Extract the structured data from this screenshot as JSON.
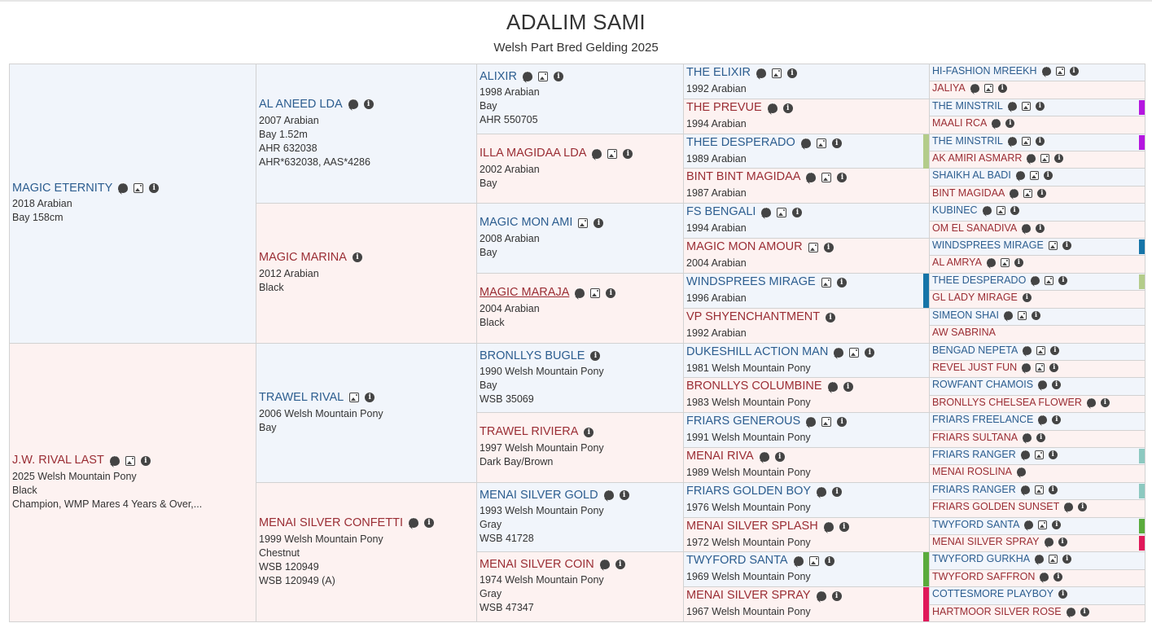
{
  "header": {
    "title": "ADALIM SAMI",
    "subtitle": "Welsh Part Bred Gelding 2025"
  },
  "pedigree": {
    "gen1": [
      {
        "name": "MAGIC ETERNITY",
        "sex": "m",
        "icons": [
          "comment",
          "image",
          "info"
        ],
        "lines": [
          "2018 Arabian",
          "Bay 158cm"
        ]
      },
      {
        "name": "J.W. RIVAL LAST",
        "sex": "f",
        "icons": [
          "comment",
          "image",
          "info"
        ],
        "lines": [
          "2025 Welsh Mountain Pony",
          "Black",
          "Champion, WMP Mares 4 Years & Over,..."
        ]
      }
    ],
    "gen2": [
      {
        "name": "AL ANEED LDA",
        "sex": "m",
        "icons": [
          "comment",
          "info"
        ],
        "lines": [
          "2007 Arabian",
          "Bay 1.52m",
          "AHR 632038",
          "AHR*632038, AAS*4286"
        ]
      },
      {
        "name": "MAGIC MARINA",
        "sex": "f",
        "icons": [
          "info"
        ],
        "lines": [
          "2012 Arabian",
          "Black"
        ]
      },
      {
        "name": "TRAWEL RIVAL",
        "sex": "m",
        "icons": [
          "image",
          "info"
        ],
        "lines": [
          "2006 Welsh Mountain Pony",
          "Bay"
        ]
      },
      {
        "name": "MENAI SILVER CONFETTI",
        "sex": "f",
        "icons": [
          "comment",
          "info"
        ],
        "lines": [
          "1999 Welsh Mountain Pony",
          "Chestnut",
          "WSB 120949",
          "WSB 120949 (A)"
        ]
      }
    ],
    "gen3": [
      {
        "name": "ALIXIR",
        "sex": "m",
        "icons": [
          "comment",
          "image",
          "info"
        ],
        "lines": [
          "1998 Arabian",
          "Bay",
          "AHR 550705"
        ]
      },
      {
        "name": "ILLA MAGIDAA LDA",
        "sex": "f",
        "icons": [
          "comment",
          "image",
          "info"
        ],
        "lines": [
          "2002 Arabian",
          "Bay"
        ]
      },
      {
        "name": "MAGIC MON AMI",
        "sex": "m",
        "icons": [
          "image",
          "info"
        ],
        "lines": [
          "2008 Arabian",
          "Bay"
        ]
      },
      {
        "name": "MAGIC MARAJA",
        "sex": "f",
        "underline": true,
        "icons": [
          "comment",
          "image",
          "info"
        ],
        "lines": [
          "2004 Arabian",
          "Black"
        ]
      },
      {
        "name": "BRONLLYS BUGLE",
        "sex": "m",
        "icons": [
          "info"
        ],
        "lines": [
          "1990 Welsh Mountain Pony",
          "Bay",
          "WSB 35069"
        ]
      },
      {
        "name": "TRAWEL RIVIERA",
        "sex": "f",
        "icons": [
          "info"
        ],
        "lines": [
          "1997 Welsh Mountain Pony",
          "Dark Bay/Brown"
        ]
      },
      {
        "name": "MENAI SILVER GOLD",
        "sex": "m",
        "icons": [
          "comment",
          "info"
        ],
        "lines": [
          "1993 Welsh Mountain Pony",
          "Gray",
          "WSB 41728"
        ]
      },
      {
        "name": "MENAI SILVER COIN",
        "sex": "f",
        "icons": [
          "comment",
          "info"
        ],
        "lines": [
          "1974 Welsh Mountain Pony",
          "Gray",
          "WSB 47347"
        ]
      }
    ],
    "gen4": [
      {
        "name": "THE ELIXIR",
        "sex": "m",
        "icons": [
          "comment",
          "image",
          "info"
        ],
        "lines": [
          "1992 Arabian"
        ]
      },
      {
        "name": "THE PREVUE",
        "sex": "f",
        "icons": [
          "comment",
          "info"
        ],
        "lines": [
          "1994 Arabian"
        ]
      },
      {
        "name": "THEE DESPERADO",
        "sex": "m",
        "icons": [
          "comment",
          "image",
          "info"
        ],
        "lines": [
          "1989 Arabian"
        ],
        "marker": "#b3cc8a"
      },
      {
        "name": "BINT BINT MAGIDAA",
        "sex": "f",
        "icons": [
          "comment",
          "image",
          "info"
        ],
        "lines": [
          "1987 Arabian"
        ]
      },
      {
        "name": "FS BENGALI",
        "sex": "m",
        "icons": [
          "comment",
          "image",
          "info"
        ],
        "lines": [
          "1994 Arabian"
        ]
      },
      {
        "name": "MAGIC MON AMOUR",
        "sex": "f",
        "icons": [
          "image",
          "info"
        ],
        "lines": [
          "2004 Arabian"
        ]
      },
      {
        "name": "WINDSPREES MIRAGE",
        "sex": "m",
        "icons": [
          "image",
          "info"
        ],
        "lines": [
          "1996 Arabian"
        ],
        "marker": "#1675a8"
      },
      {
        "name": "VP SHYENCHANTMENT",
        "sex": "f",
        "icons": [
          "info"
        ],
        "lines": [
          "1992 Arabian"
        ]
      },
      {
        "name": "DUKESHILL ACTION MAN",
        "sex": "m",
        "icons": [
          "comment",
          "image",
          "info"
        ],
        "lines": [
          "1981 Welsh Mountain Pony"
        ]
      },
      {
        "name": "BRONLLYS COLUMBINE",
        "sex": "f",
        "icons": [
          "comment",
          "info"
        ],
        "lines": [
          "1983 Welsh Mountain Pony"
        ]
      },
      {
        "name": "FRIARS GENEROUS",
        "sex": "m",
        "icons": [
          "comment",
          "image",
          "info"
        ],
        "lines": [
          "1991 Welsh Mountain Pony"
        ]
      },
      {
        "name": "MENAI RIVA",
        "sex": "f",
        "icons": [
          "comment",
          "info"
        ],
        "lines": [
          "1989 Welsh Mountain Pony"
        ]
      },
      {
        "name": "FRIARS GOLDEN BOY",
        "sex": "m",
        "icons": [
          "comment",
          "info"
        ],
        "lines": [
          "1976 Welsh Mountain Pony"
        ]
      },
      {
        "name": "MENAI SILVER SPLASH",
        "sex": "f",
        "icons": [
          "comment",
          "info"
        ],
        "lines": [
          "1972 Welsh Mountain Pony"
        ]
      },
      {
        "name": "TWYFORD SANTA",
        "sex": "m",
        "icons": [
          "comment",
          "image",
          "info"
        ],
        "lines": [
          "1969 Welsh Mountain Pony"
        ],
        "marker": "#5aab3c"
      },
      {
        "name": "MENAI SILVER SPRAY",
        "sex": "f",
        "icons": [
          "comment",
          "info"
        ],
        "lines": [
          "1967 Welsh Mountain Pony"
        ],
        "marker": "#e0195a"
      }
    ],
    "gen5": [
      {
        "name": "HI-FASHION MREEKH",
        "sex": "m",
        "icons": [
          "comment",
          "image",
          "info"
        ]
      },
      {
        "name": "JALIYA",
        "sex": "f",
        "icons": [
          "comment",
          "image",
          "info"
        ]
      },
      {
        "name": "THE MINSTRIL",
        "sex": "m",
        "icons": [
          "comment",
          "image",
          "info"
        ],
        "marker": "#b516e0"
      },
      {
        "name": "MAALI RCA",
        "sex": "f",
        "icons": [
          "comment",
          "info"
        ]
      },
      {
        "name": "THE MINSTRIL",
        "sex": "m",
        "icons": [
          "comment",
          "image",
          "info"
        ],
        "marker": "#b516e0"
      },
      {
        "name": "AK AMIRI ASMARR",
        "sex": "f",
        "icons": [
          "comment",
          "image",
          "info"
        ]
      },
      {
        "name": "SHAIKH AL BADI",
        "sex": "m",
        "icons": [
          "comment",
          "image",
          "info"
        ]
      },
      {
        "name": "BINT MAGIDAA",
        "sex": "f",
        "icons": [
          "comment",
          "image",
          "info"
        ]
      },
      {
        "name": "KUBINEC",
        "sex": "m",
        "icons": [
          "comment",
          "image",
          "info"
        ]
      },
      {
        "name": "OM EL SANADIVA",
        "sex": "f",
        "icons": [
          "comment",
          "info"
        ]
      },
      {
        "name": "WINDSPREES MIRAGE",
        "sex": "m",
        "icons": [
          "image",
          "info"
        ],
        "marker": "#1675a8"
      },
      {
        "name": "AL AMRYA",
        "sex": "f",
        "icons": [
          "comment",
          "image",
          "info"
        ]
      },
      {
        "name": "THEE DESPERADO",
        "sex": "m",
        "icons": [
          "comment",
          "image",
          "info"
        ],
        "marker": "#b3cc8a"
      },
      {
        "name": "GL LADY MIRAGE",
        "sex": "f",
        "icons": [
          "info"
        ]
      },
      {
        "name": "SIMEON SHAI",
        "sex": "m",
        "icons": [
          "comment",
          "image",
          "info"
        ]
      },
      {
        "name": "AW SABRINA",
        "sex": "f",
        "icons": []
      },
      {
        "name": "BENGAD NEPETA",
        "sex": "m",
        "icons": [
          "comment",
          "image",
          "info"
        ]
      },
      {
        "name": "REVEL JUST FUN",
        "sex": "f",
        "icons": [
          "comment",
          "image",
          "info"
        ]
      },
      {
        "name": "ROWFANT CHAMOIS",
        "sex": "m",
        "icons": [
          "comment",
          "info"
        ]
      },
      {
        "name": "BRONLLYS CHELSEA FLOWER",
        "sex": "f",
        "icons": [
          "comment",
          "info"
        ]
      },
      {
        "name": "FRIARS FREELANCE",
        "sex": "m",
        "icons": [
          "comment",
          "info"
        ]
      },
      {
        "name": "FRIARS SULTANA",
        "sex": "f",
        "icons": [
          "comment",
          "info"
        ]
      },
      {
        "name": "FRIARS RANGER",
        "sex": "m",
        "icons": [
          "comment",
          "image",
          "info"
        ],
        "marker": "#8cc9c0"
      },
      {
        "name": "MENAI ROSLINA",
        "sex": "f",
        "icons": [
          "comment"
        ]
      },
      {
        "name": "FRIARS RANGER",
        "sex": "m",
        "icons": [
          "comment",
          "image",
          "info"
        ],
        "marker": "#8cc9c0"
      },
      {
        "name": "FRIARS GOLDEN SUNSET",
        "sex": "f",
        "icons": [
          "comment",
          "info"
        ]
      },
      {
        "name": "TWYFORD SANTA",
        "sex": "m",
        "icons": [
          "comment",
          "image",
          "info"
        ],
        "marker": "#5aab3c"
      },
      {
        "name": "MENAI SILVER SPRAY",
        "sex": "f",
        "icons": [
          "comment",
          "info"
        ],
        "marker": "#e0195a"
      },
      {
        "name": "TWYFORD GURKHA",
        "sex": "m",
        "icons": [
          "comment",
          "image",
          "info"
        ]
      },
      {
        "name": "TWYFORD SAFFRON",
        "sex": "f",
        "icons": [
          "comment",
          "info"
        ]
      },
      {
        "name": "COTTESMORE PLAYBOY",
        "sex": "m",
        "icons": [
          "info"
        ]
      },
      {
        "name": "HARTMOOR SILVER ROSE",
        "sex": "f",
        "icons": [
          "comment",
          "info"
        ]
      }
    ]
  }
}
